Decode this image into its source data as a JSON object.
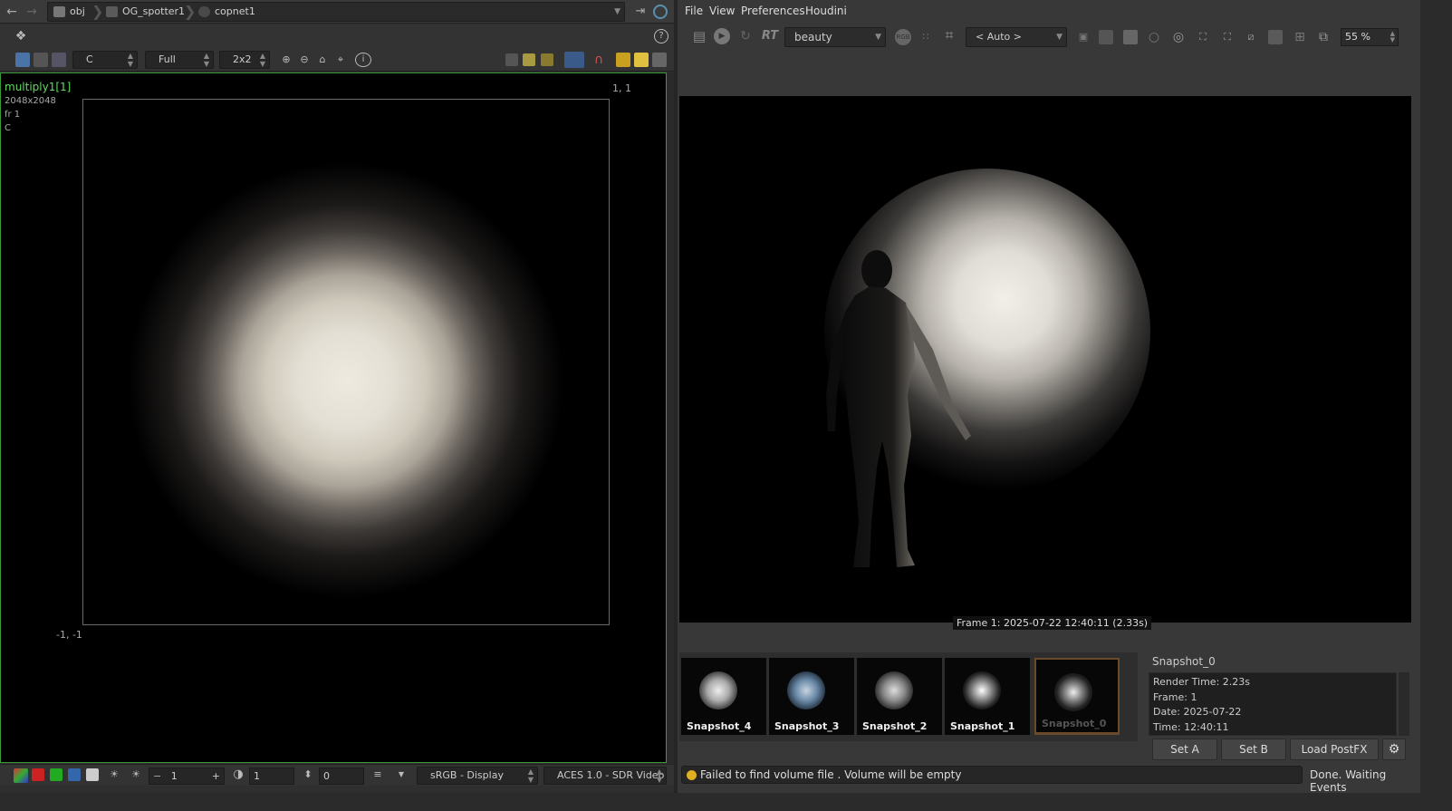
{
  "path": {
    "segments": [
      "obj",
      "OG_spotter1",
      "copnet1"
    ]
  },
  "left_toolbar": {
    "channel": "C",
    "resolution": "Full",
    "grid": "2x2"
  },
  "viewport": {
    "node_name": "multiply1[1]",
    "size": "2048x2048",
    "frame": "fr 1",
    "channel": "C",
    "top_right_coord": "1, 1",
    "bottom_left_coord": "-1, -1"
  },
  "left_bottom": {
    "exposure_value": "1",
    "gamma_value": "1",
    "offset_value": "0",
    "display": "sRGB - Display",
    "view": "ACES 1.0 - SDR Video"
  },
  "menu": [
    "File",
    "View",
    "Preferences",
    "Houdini"
  ],
  "render_toolbar": {
    "rt_label": "RT",
    "aov": "beauty",
    "camera": "< Auto >",
    "zoom": "55 %"
  },
  "render": {
    "frame_label": "Frame 1:  2025-07-22  12:40:11  (2.33s)"
  },
  "snapshots": [
    "Snapshot_4",
    "Snapshot_3",
    "Snapshot_2",
    "Snapshot_1",
    "Snapshot_0"
  ],
  "snapshot_info": {
    "title": "Snapshot_0",
    "lines": [
      "Render Time: 2.23s",
      "Frame: 1",
      "Date: 2025-07-22",
      "Time: 12:40:11"
    ]
  },
  "buttons": {
    "set_a": "Set A",
    "set_b": "Set B",
    "load_postfx": "Load PostFX"
  },
  "status": {
    "message": "Failed to find volume file . Volume will be empty",
    "state": "Done. Waiting Events"
  },
  "colors": {
    "accent_green": "#3a9a3a",
    "node_label_green": "#5fdc5f",
    "warning_yellow": "#e0b020"
  }
}
